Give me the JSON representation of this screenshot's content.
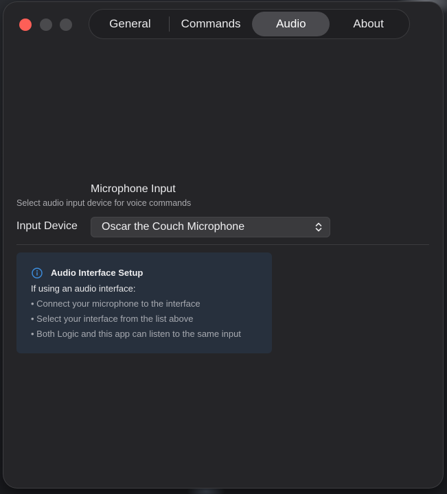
{
  "tabs": [
    {
      "label": "General",
      "active": false
    },
    {
      "label": "Commands",
      "active": false
    },
    {
      "label": "Audio",
      "active": true
    },
    {
      "label": "About",
      "active": false
    }
  ],
  "microphone": {
    "title": "Microphone Input",
    "subtitle": "Select audio input device for voice commands",
    "device_label": "Input Device",
    "selected_device": "Oscar the Couch Microphone"
  },
  "info": {
    "icon": "info-circle-icon",
    "title": "Audio Interface Setup",
    "intro": "If using an audio interface:",
    "items": [
      "• Connect your microphone to the interface",
      "• Select your interface from the list above",
      "• Both Logic and this app can listen to the same input"
    ]
  },
  "colors": {
    "close": "#fe5f57",
    "accent_info": "#3d8fe0",
    "window_bg": "#252528",
    "info_bg": "#27303d"
  }
}
